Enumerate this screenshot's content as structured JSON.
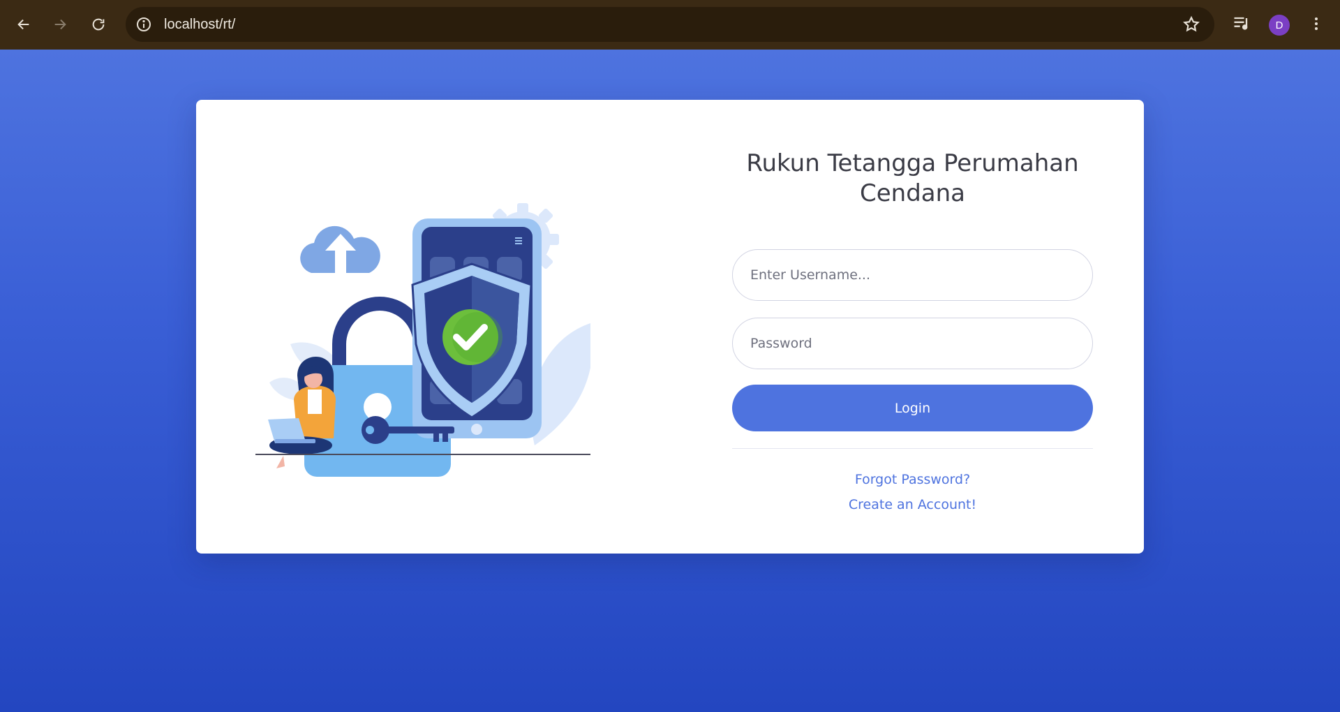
{
  "browser": {
    "url": "localhost/rt/",
    "profile_initial": "D"
  },
  "login": {
    "title": "Rukun Tetangga Perumahan Cendana",
    "username_placeholder": "Enter Username...",
    "password_placeholder": "Password",
    "login_label": "Login",
    "forgot_label": "Forgot Password?",
    "create_label": "Create an Account!"
  },
  "colors": {
    "primary": "#4e73df",
    "page_gradient_top": "#4e73df",
    "page_gradient_bottom": "#2346c0"
  }
}
